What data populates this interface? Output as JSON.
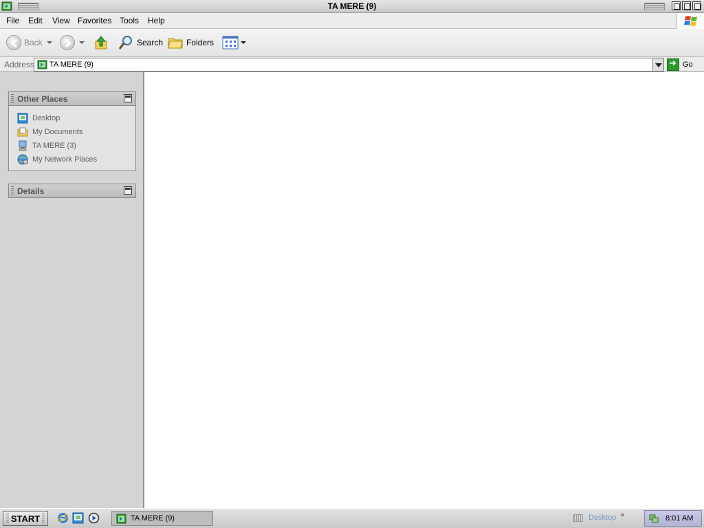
{
  "window": {
    "title": "TA MERE (9)"
  },
  "menu": {
    "items": [
      "File",
      "Edit",
      "View",
      "Favorites",
      "Tools",
      "Help"
    ]
  },
  "toolbar": {
    "back_label": "Back",
    "search_label": "Search",
    "folders_label": "Folders"
  },
  "address": {
    "label": "Address",
    "value": "TA MERE (9)",
    "go_label": "Go"
  },
  "sidebar": {
    "other_places": {
      "title": "Other Places",
      "items": [
        {
          "label": "Desktop",
          "icon": "desktop-icon"
        },
        {
          "label": "My Documents",
          "icon": "my-documents-icon"
        },
        {
          "label": "TA MERE (3)",
          "icon": "computer-icon"
        },
        {
          "label": "My Network Places",
          "icon": "network-places-icon"
        }
      ]
    },
    "details": {
      "title": "Details"
    }
  },
  "taskbar": {
    "start_label": "START",
    "quick_launch": [
      "internet-explorer-icon",
      "show-desktop-icon",
      "media-player-icon"
    ],
    "active_task": "TA MERE (9)",
    "desktop_toolbar_label": "Desktop",
    "chevron": "»",
    "clock": "8:01 AM"
  },
  "colors": {
    "panel_bg": "#d4d4d4",
    "content_bg": "#ffffff",
    "go_green": "#2e9a2e",
    "tray_bg": "#c2c2e2"
  }
}
